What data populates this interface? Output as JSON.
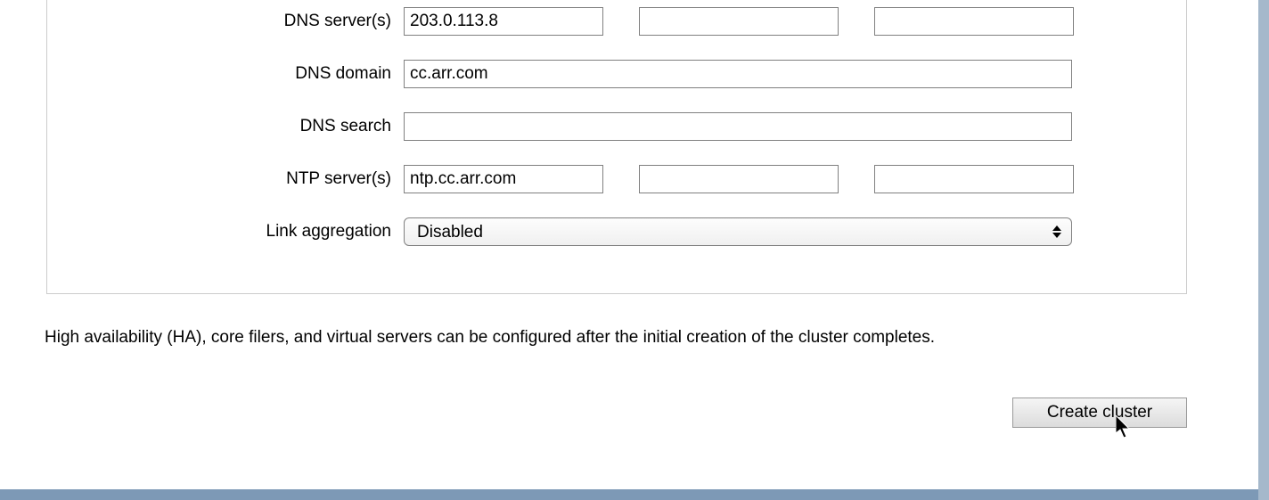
{
  "form": {
    "dns_servers": {
      "label": "DNS server(s)",
      "values": [
        "203.0.113.8",
        "",
        ""
      ]
    },
    "dns_domain": {
      "label": "DNS domain",
      "value": "cc.arr.com"
    },
    "dns_search": {
      "label": "DNS search",
      "value": ""
    },
    "ntp_servers": {
      "label": "NTP server(s)",
      "values": [
        "ntp.cc.arr.com",
        "",
        ""
      ]
    },
    "link_aggregation": {
      "label": "Link aggregation",
      "selected": "Disabled"
    }
  },
  "note": "High availability (HA), core filers, and virtual servers can be configured after the initial creation of the cluster completes.",
  "create_button_label": "Create cluster"
}
